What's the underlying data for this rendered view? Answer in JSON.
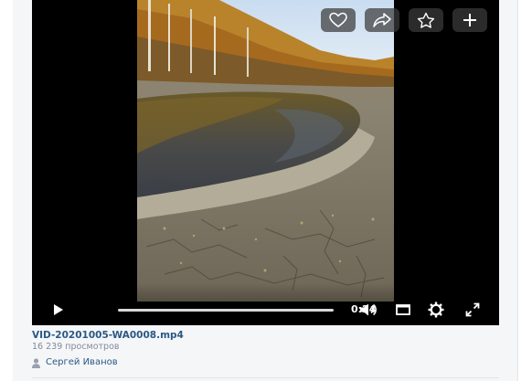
{
  "video": {
    "file_name": "VID-20201005-WA0008.mp4",
    "views": "16 239 просмотров",
    "author": "Сергей Иванов",
    "current_time": "0:24",
    "progress_fraction": 0.0
  },
  "controls": {
    "top": [
      {
        "name": "like-button",
        "icon": "heart-icon"
      },
      {
        "name": "share-button",
        "icon": "share-arrow-icon"
      },
      {
        "name": "add-to-favorites-button",
        "icon": "star-icon"
      },
      {
        "name": "add-video-button",
        "icon": "plus-icon"
      }
    ],
    "bottom": [
      "play-icon",
      "volume-icon",
      "miniplayer-icon",
      "settings-gear-icon",
      "fullscreen-icon"
    ]
  },
  "colors": {
    "link": "#2a5885",
    "muted": "#828a99",
    "player_bg": "#000000"
  }
}
